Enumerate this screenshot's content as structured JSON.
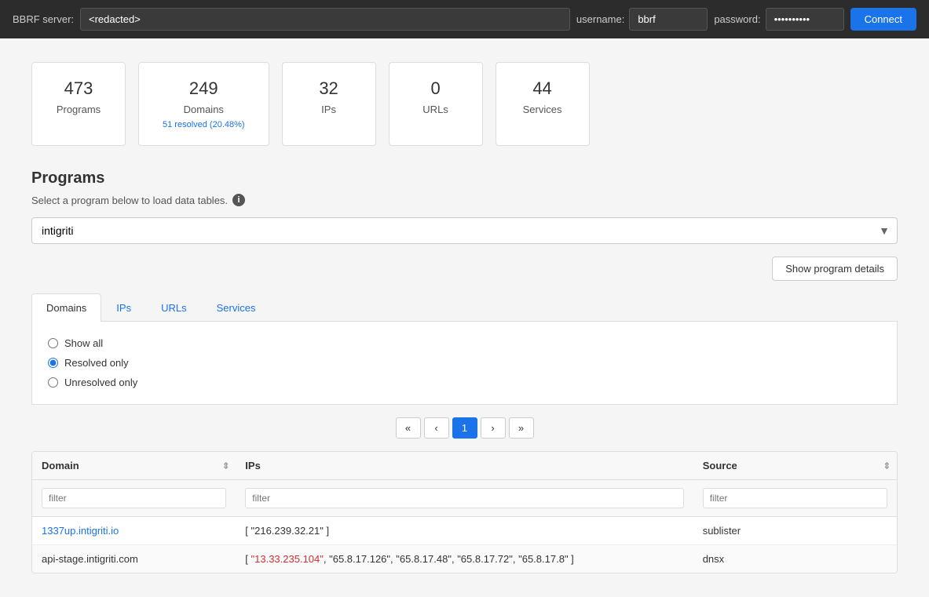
{
  "header": {
    "server_label": "BBRF server:",
    "server_value": "<redacted>",
    "username_label": "username:",
    "username_value": "bbrf",
    "password_label": "password:",
    "password_value": "••••••••••",
    "connect_label": "Connect"
  },
  "stats": [
    {
      "id": "programs",
      "number": "473",
      "label": "Programs",
      "sub": null
    },
    {
      "id": "domains",
      "number": "249",
      "label": "Domains",
      "sub": "51 resolved (20.48%)"
    },
    {
      "id": "ips",
      "number": "32",
      "label": "IPs",
      "sub": null
    },
    {
      "id": "urls",
      "number": "0",
      "label": "URLs",
      "sub": null
    },
    {
      "id": "services",
      "number": "44",
      "label": "Services",
      "sub": null
    }
  ],
  "programs": {
    "section_title": "Programs",
    "section_desc": "Select a program below to load data tables.",
    "selected_program": "intigriti",
    "show_details_label": "Show program details"
  },
  "tabs": [
    {
      "id": "domains",
      "label": "Domains",
      "active": true
    },
    {
      "id": "ips",
      "label": "IPs",
      "active": false
    },
    {
      "id": "urls",
      "label": "URLs",
      "active": false
    },
    {
      "id": "services",
      "label": "Services",
      "active": false
    }
  ],
  "filter_panel": {
    "show_all_label": "Show all",
    "resolved_label": "Resolved only",
    "unresolved_label": "Unresolved only",
    "selected": "resolved"
  },
  "pagination": {
    "first_label": "«",
    "prev_label": "‹",
    "current_page": 1,
    "next_label": "›",
    "last_label": "»"
  },
  "table": {
    "columns": [
      {
        "id": "domain",
        "label": "Domain"
      },
      {
        "id": "ips",
        "label": "IPs"
      },
      {
        "id": "source",
        "label": "Source"
      }
    ],
    "filters": {
      "domain_placeholder": "filter",
      "ips_placeholder": "filter",
      "source_placeholder": "filter"
    },
    "rows": [
      {
        "domain": "1337up.intigriti.io",
        "ips": "[ \"216.239.32.21\" ]",
        "source": "sublister",
        "domain_link": true,
        "ip_highlight": false
      },
      {
        "domain": "api-stage.intigriti.com",
        "ips": "[ \"13.33.235.104\", \"65.8.17.126\", \"65.8.17.48\", \"65.8.17.72\", \"65.8.17.8\" ]",
        "source": "dnsx",
        "domain_link": false,
        "ip_highlight": true
      }
    ]
  }
}
